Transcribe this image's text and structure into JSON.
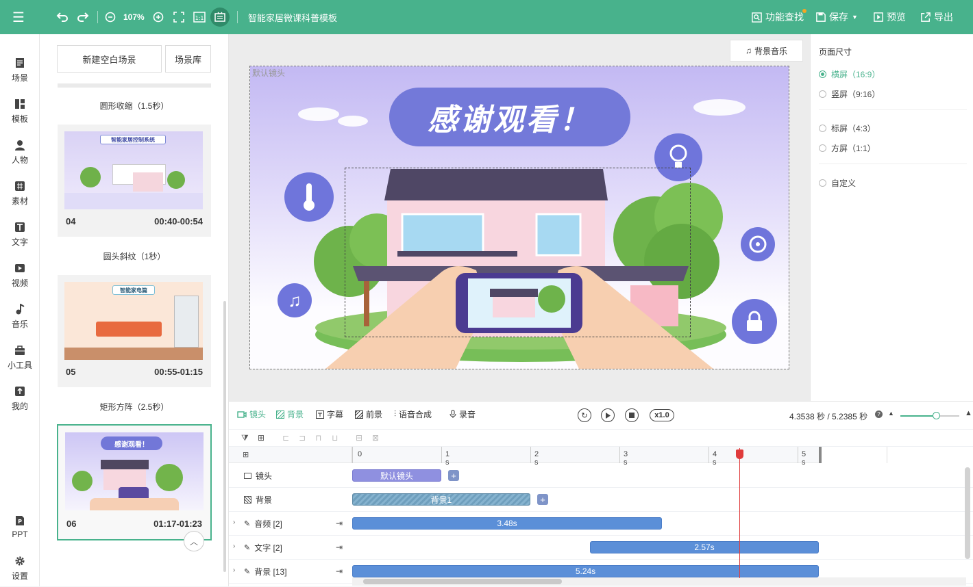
{
  "topbar": {
    "zoom": "107%",
    "title": "智能家居微课科普模板",
    "search_label": "功能查找",
    "save_label": "保存",
    "preview_label": "预览",
    "export_label": "导出"
  },
  "sidebar": {
    "items": [
      {
        "label": "场景",
        "icon": "scene-icon"
      },
      {
        "label": "模板",
        "icon": "template-icon"
      },
      {
        "label": "人物",
        "icon": "person-icon"
      },
      {
        "label": "素材",
        "icon": "material-icon"
      },
      {
        "label": "文字",
        "icon": "text-icon"
      },
      {
        "label": "视频",
        "icon": "video-icon"
      },
      {
        "label": "音乐",
        "icon": "music-icon"
      },
      {
        "label": "小工具",
        "icon": "toolbox-icon"
      },
      {
        "label": "我的",
        "icon": "upload-icon"
      },
      {
        "label": "PPT",
        "icon": "ppt-icon"
      },
      {
        "label": "设置",
        "icon": "gear-icon"
      }
    ]
  },
  "scene_panel": {
    "new_scene_label": "新建空白场景",
    "library_label": "场景库",
    "transitions": [
      "圆形收缩（1.5秒）",
      "圆头斜纹（1秒）",
      "矩形方阵（2.5秒）"
    ],
    "scenes": [
      {
        "num": "04",
        "time": "00:40-00:54",
        "thumb_title": "智能家居控制系统"
      },
      {
        "num": "05",
        "time": "00:55-01:15",
        "thumb_title": "智能家电篇"
      },
      {
        "num": "06",
        "time": "01:17-01:23",
        "thumb_title": "感谢观看！"
      }
    ]
  },
  "canvas": {
    "bg_music_label": "背景音乐",
    "lens_label": "默认镜头",
    "banner_text": "感谢观看！"
  },
  "page_size": {
    "title": "页面尺寸",
    "options": [
      {
        "label": "横屏（16:9）",
        "selected": true
      },
      {
        "label": "竖屏（9:16）",
        "selected": false
      },
      {
        "label": "标屏（4:3）",
        "selected": false
      },
      {
        "label": "方屏（1:1）",
        "selected": false
      },
      {
        "label": "自定义",
        "selected": false
      }
    ]
  },
  "timeline": {
    "tabs": [
      "镜头",
      "背景",
      "字幕",
      "前景",
      "语音合成",
      "录音"
    ],
    "speed": "x1.0",
    "time_display": "4.3538 秒 / 5.2385 秒",
    "ruler": [
      "0",
      "1 s",
      "2 s",
      "3 s",
      "4 s",
      "5 s"
    ],
    "playhead_seconds": 4.3538,
    "total_seconds": 5.2385,
    "tracks": [
      {
        "label": "镜头",
        "clip_label": "默认镜头",
        "start": 0,
        "end": 1.0
      },
      {
        "label": "背景",
        "clip_label": "背景1",
        "start": 0,
        "end": 2.0
      },
      {
        "label": "音频 [2]",
        "clip_label": "3.48s",
        "start": 0,
        "end": 3.48
      },
      {
        "label": "文字 [2]",
        "clip_label": "2.57s",
        "start": 2.67,
        "end": 5.24
      },
      {
        "label": "背景 [13]",
        "clip_label": "5.24s",
        "start": 0,
        "end": 5.24
      }
    ]
  },
  "colors": {
    "accent": "#48b28c",
    "clip_blue": "#5b8fd8",
    "lens_purple": "#8f90e0",
    "playhead": "#e03b3b"
  }
}
